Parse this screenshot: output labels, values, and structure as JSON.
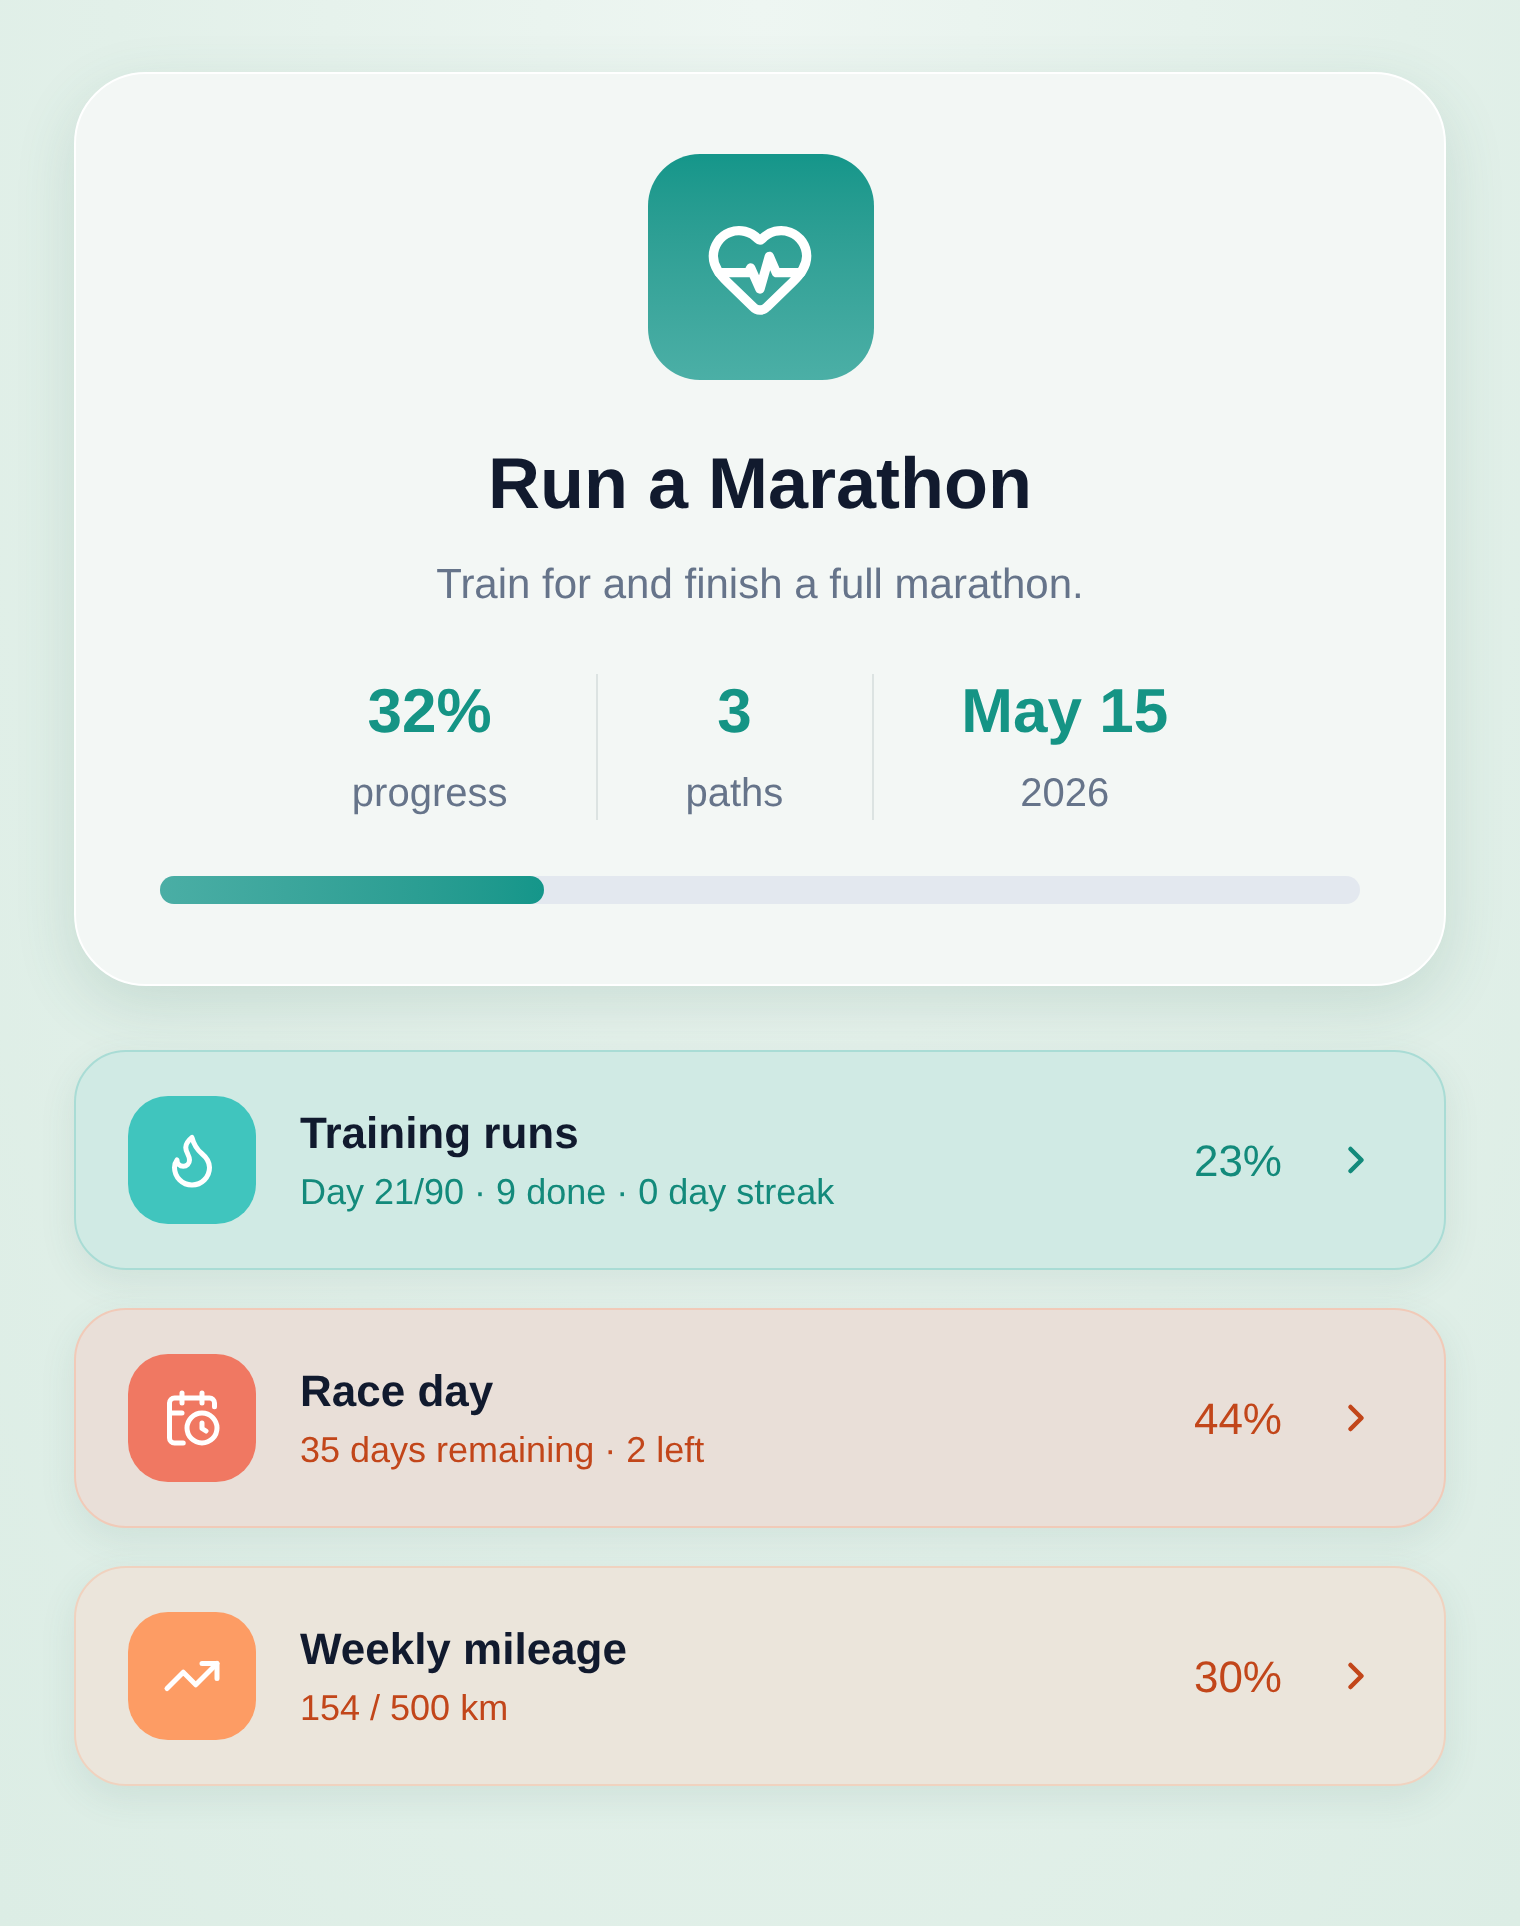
{
  "goal": {
    "title": "Run a Marathon",
    "description": "Train for and finish a full marathon.",
    "stats": [
      {
        "value": "32%",
        "label": "progress"
      },
      {
        "value": "3",
        "label": "paths"
      },
      {
        "value": "May 15",
        "label": "2026"
      }
    ],
    "progress": {
      "level": 0.32
    }
  },
  "paths": [
    {
      "kind": "habit",
      "title": "Training runs",
      "details": "Day 21/90 · 9 done · 0 day streak",
      "percent": "23%",
      "color": "#40c5be"
    },
    {
      "kind": "deadline",
      "title": "Race day",
      "details": "35 days remaining · 2 left",
      "percent": "44%",
      "color": "#f07862"
    },
    {
      "kind": "metric",
      "title": "Weekly mileage",
      "details": "154 / 500 km",
      "percent": "30%",
      "color": "#fd9c64"
    }
  ]
}
